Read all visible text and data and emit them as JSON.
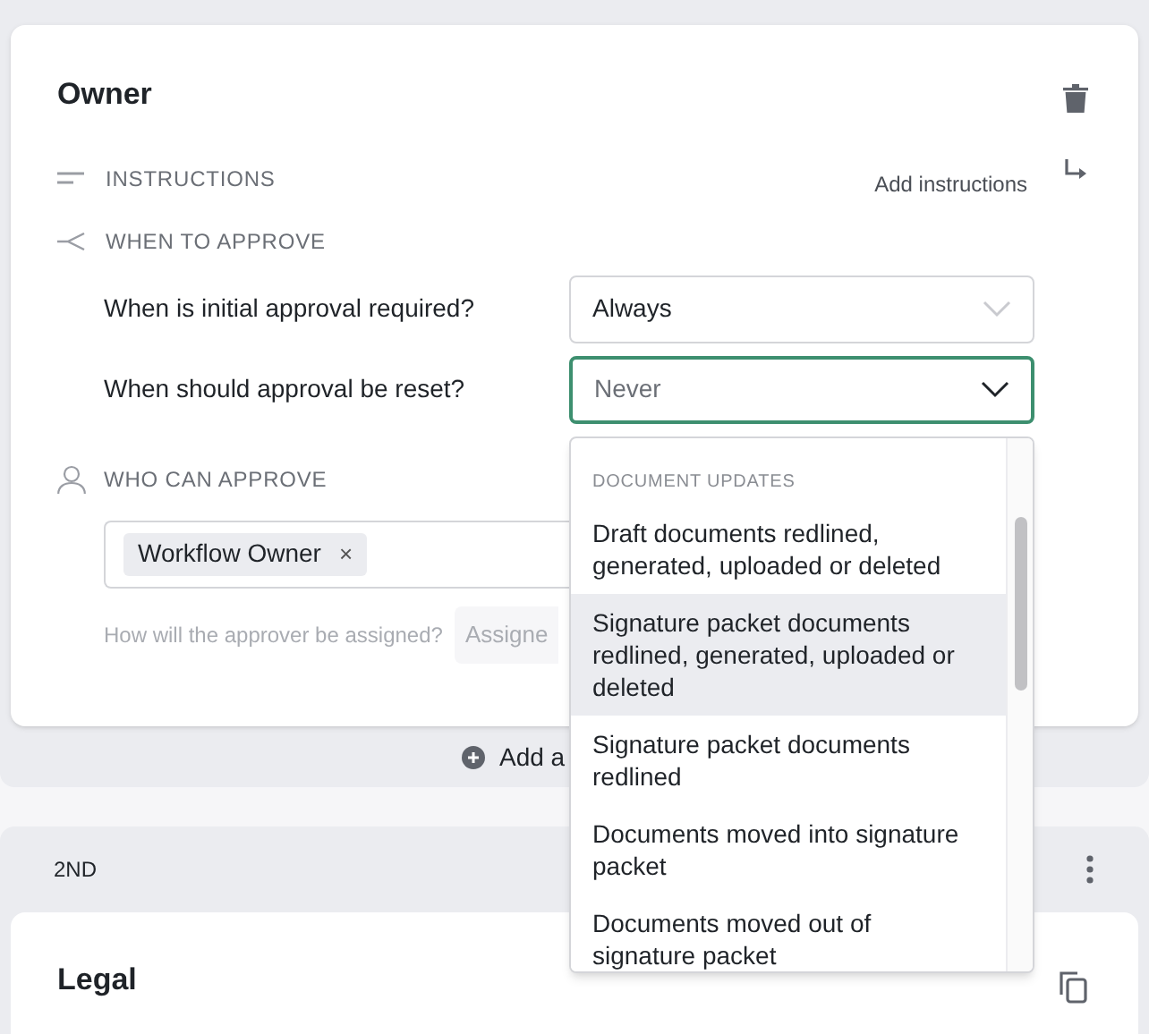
{
  "owner_card": {
    "title": "Owner",
    "instructions": {
      "label": "INSTRUCTIONS",
      "action": "Add instructions"
    },
    "when_to_approve": {
      "label": "WHEN TO APPROVE",
      "questions": [
        {
          "label": "When is initial approval required?",
          "value": "Always",
          "focused": false
        },
        {
          "label": "When should approval be reset?",
          "value": "Never",
          "focused": true
        }
      ]
    },
    "who_can_approve": {
      "label": "WHO CAN APPROVE",
      "approvers": [
        {
          "label": "Workflow Owner"
        }
      ],
      "remove_glyph": "×",
      "assignment": {
        "label": "How will the approver be assigned?",
        "placeholder": "Assigne"
      }
    }
  },
  "add_approver": {
    "label": "Add a"
  },
  "stage_2": {
    "label": "2ND",
    "card_title": "Legal"
  },
  "dropdown": {
    "group_label": "DOCUMENT UPDATES",
    "options": [
      {
        "label": "Draft documents redlined, generated, uploaded or deleted",
        "highlighted": false
      },
      {
        "label": "Signature packet documents redlined, generated, uploaded or deleted",
        "highlighted": true
      },
      {
        "label": "Signature packet documents redlined",
        "highlighted": false
      },
      {
        "label": "Documents moved into signature packet",
        "highlighted": false
      },
      {
        "label": "Documents moved out of signature packet",
        "highlighted": false
      }
    ]
  }
}
